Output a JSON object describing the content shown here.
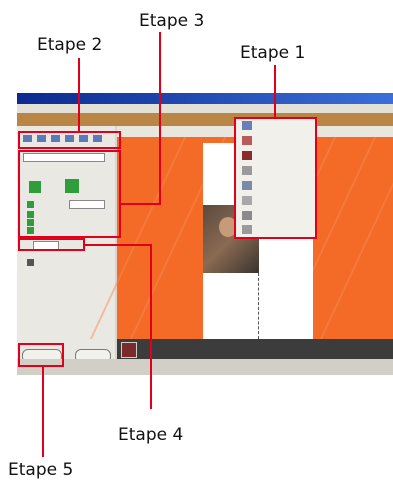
{
  "annotations": {
    "etape1": "Etape 1",
    "etape2": "Etape 2",
    "etape3": "Etape 3",
    "etape4": "Etape 4",
    "etape5": "Etape 5"
  },
  "colors": {
    "annotation_red": "#e0001b",
    "workspace_orange": "#f46b28"
  }
}
